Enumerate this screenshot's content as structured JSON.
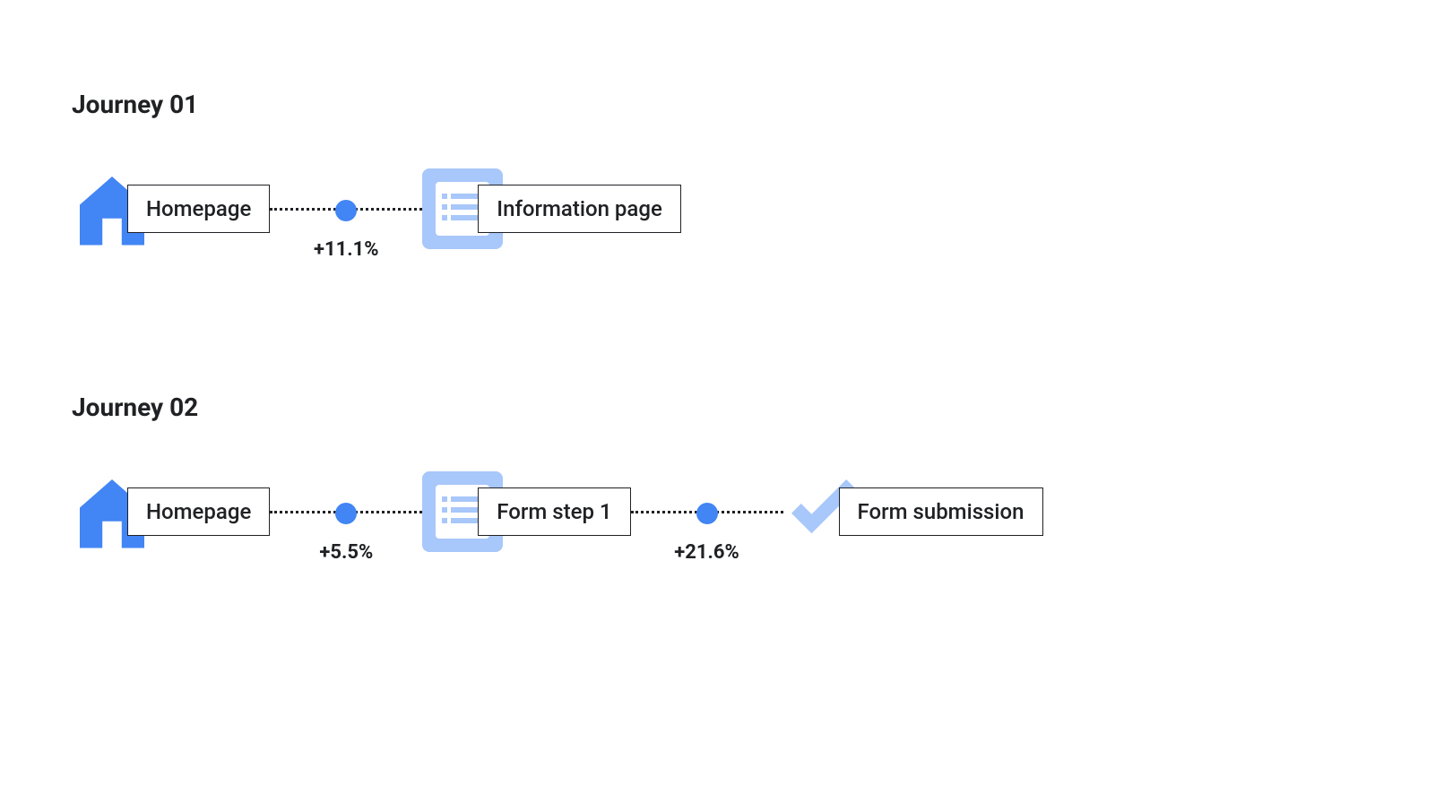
{
  "journeys": [
    {
      "title": "Journey 01",
      "nodes": [
        {
          "icon": "home",
          "label": "Homepage"
        },
        {
          "icon": "list",
          "label": "Information page"
        }
      ],
      "connectors": [
        {
          "value": "+11.1%"
        }
      ]
    },
    {
      "title": "Journey 02",
      "nodes": [
        {
          "icon": "home",
          "label": "Homepage"
        },
        {
          "icon": "list",
          "label": "Form step 1"
        },
        {
          "icon": "check",
          "label": "Form submission"
        }
      ],
      "connectors": [
        {
          "value": "+5.5%"
        },
        {
          "value": "+21.6%"
        }
      ]
    }
  ],
  "colors": {
    "primary_blue": "#4285F4",
    "light_blue": "#A8C7FA",
    "text": "#202124"
  }
}
